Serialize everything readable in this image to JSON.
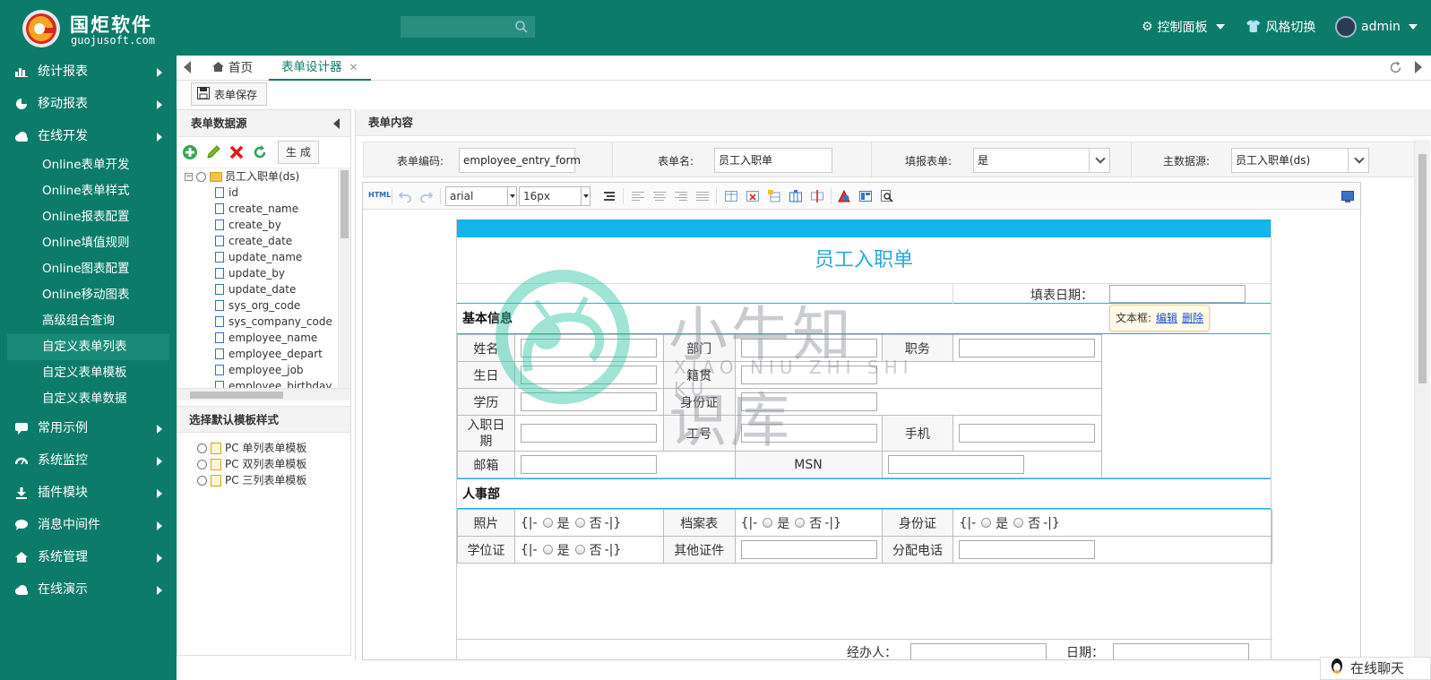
{
  "header": {
    "brand": "国炬软件",
    "brand_url": "guojusoft.com",
    "search_placeholder": "",
    "control_panel": "控制面板",
    "style_switch": "风格切换",
    "user": "admin"
  },
  "sidebar": {
    "items": [
      {
        "label": "统计报表",
        "icon": "bar-chart-icon"
      },
      {
        "label": "移动报表",
        "icon": "pie-chart-icon"
      },
      {
        "label": "在线开发",
        "icon": "cloud-icon"
      }
    ],
    "sub_items": [
      "Online表单开发",
      "Online表单样式",
      "Online报表配置",
      "Online填值规则",
      "Online图表配置",
      "Online移动图表",
      "高级组合查询",
      "自定义表单列表",
      "自定义表单模板",
      "自定义表单数据"
    ],
    "active_sub": "自定义表单列表",
    "items_after": [
      {
        "label": "常用示例",
        "icon": "comment-icon"
      },
      {
        "label": "系统监控",
        "icon": "dashboard-icon"
      },
      {
        "label": "插件模块",
        "icon": "download-icon"
      },
      {
        "label": "消息中间件",
        "icon": "chat-icon"
      },
      {
        "label": "系统管理",
        "icon": "home-icon"
      },
      {
        "label": "在线演示",
        "icon": "cloud-icon"
      }
    ]
  },
  "tabs": {
    "home": "首页",
    "designer": "表单设计器"
  },
  "toolbar": {
    "save": "表单保存"
  },
  "left_panel": {
    "title": "表单数据源",
    "generate": "生 成",
    "root": "员工入职单(ds)",
    "fields": [
      "id",
      "create_name",
      "create_by",
      "create_date",
      "update_name",
      "update_by",
      "update_date",
      "sys_org_code",
      "sys_company_code",
      "employee_name",
      "employee_depart",
      "employee_job",
      "employee_birthday"
    ],
    "template_title": "选择默认模板样式",
    "templates": [
      "PC 单列表单模板",
      "PC 双列表单模板",
      "PC 三列表单模板"
    ]
  },
  "right_panel": {
    "title": "表单内容",
    "code_label": "表单编码:",
    "code_value": "employee_entry_form",
    "name_label": "表单名:",
    "name_value": "员工入职单",
    "fill_label": "填报表单:",
    "fill_value": "是",
    "ds_label": "主数据源:",
    "ds_value": "员工入职单(ds)"
  },
  "editor": {
    "html_label": "HTML",
    "font": "arial",
    "size": "16px"
  },
  "form": {
    "title": "员工入职单",
    "date_label": "填表日期：",
    "tip_label": "文本框:",
    "tip_edit": "编辑",
    "tip_delete": "删除",
    "sec_basic": "基本信息",
    "name": "姓名",
    "dept": "部门",
    "job": "职务",
    "birthday": "生日",
    "native": "籍贯",
    "edu": "学历",
    "idcard": "身份证",
    "entry_date": "入职日期",
    "work_no": "工号",
    "mobile": "手机",
    "email": "邮箱",
    "msn": "MSN",
    "sec_hr": "人事部",
    "photo": "照片",
    "archive": "档案表",
    "idcard2": "身份证",
    "degree": "学位证",
    "other_cert": "其他证件",
    "phone_alloc": "分配电话",
    "radio_open": "{|-",
    "yes": "是",
    "no": "否",
    "radio_close": "-|}",
    "handler": "经办人：",
    "date2": "日期："
  },
  "watermark": {
    "title": "小牛知识库",
    "pinyin": "XIAO NIU ZHI SHI KU"
  },
  "chat": "在线聊天"
}
